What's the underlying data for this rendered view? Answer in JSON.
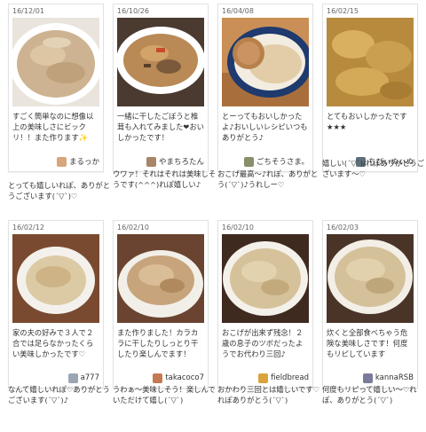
{
  "cards": [
    {
      "date": "16/12/01",
      "message": "すごく簡単なのに想像以上の美味しさにビックリ！！また作ります✨",
      "author": "まるっか",
      "reply": "とっても嬉しいれぽ、ありがとうございます(´▽`)♡"
    },
    {
      "date": "16/10/26",
      "message": "一緒に干したごぼうと椎茸も入れてみました❤おいしかったです！",
      "author": "やまちろたん",
      "reply": "ウワァ！それはそれは美味しそうです(^^^)れぽ嬉しい♪"
    },
    {
      "date": "16/04/08",
      "message": "とーってもおいしかったよ♪おいしいレシピいつもありがとう♪",
      "author": "ごちそうさま。",
      "reply": "おこげ最高〜♪れぽ、ありがとう(´▽`)♪うれしー♡"
    },
    {
      "date": "16/02/15",
      "message": "とてもおいしかったです★★★",
      "author": "ちびぃぬぃぬ",
      "reply": "嬉しい(´▽`)/れぽありがとうございます〜♡"
    },
    {
      "date": "16/02/12",
      "message": "家の夫の好みで３人で２合では足らなかったくらい美味しかったです♡",
      "author": "a777",
      "reply": "なんて嬉しいれぽ♡ありがとうございます(´▽`)♪"
    },
    {
      "date": "16/02/10",
      "message": "また作りました！カラカラに干したりしっとり干したり楽しんでます！",
      "author": "takacoco7",
      "reply": "うわぁ〜美味しそう！楽しんでいただけて嬉し(´▽`)"
    },
    {
      "date": "16/02/10",
      "message": "おこげが出来ず残念！２歳の息子のツボだったようでお代わり三回♪",
      "author": "fieldbread",
      "reply": "おかわり三回とは嬉しいです♡れぽありがとう(´▽`)"
    },
    {
      "date": "16/02/03",
      "message": "炊くと全部食べちゃう危険な美味しさです！何度もリピしています",
      "author": "kannaRSB",
      "reply": "何度もリピって嬉しい〜♡れぽ、ありがとう(´▽`)"
    }
  ]
}
